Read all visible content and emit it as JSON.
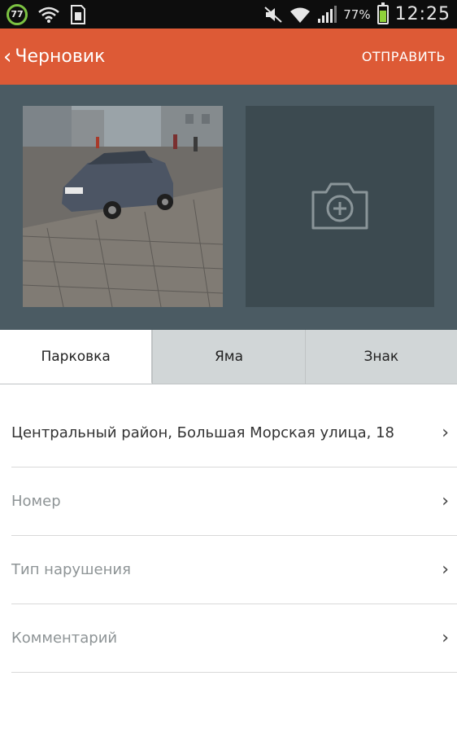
{
  "status_bar": {
    "notification_badge": "77",
    "battery_percent": "77%",
    "battery_level": 0.77,
    "time": "12:25"
  },
  "app_bar": {
    "title": "Черновик",
    "send_label": "ОТПРАВИТЬ"
  },
  "tabs": [
    {
      "label": "Парковка",
      "active": true
    },
    {
      "label": "Яма",
      "active": false
    },
    {
      "label": "Знак",
      "active": false
    }
  ],
  "form": {
    "address": "Центральный район, Большая Морская улица, 18",
    "number_placeholder": "Номер",
    "violation_type_placeholder": "Тип нарушения",
    "comment_placeholder": "Комментарий"
  },
  "colors": {
    "app_bar": "#dd5a36",
    "photo_area": "#4b5b63",
    "add_photo_tile": "#3c4a50",
    "battery_fill": "#8fd13a"
  }
}
